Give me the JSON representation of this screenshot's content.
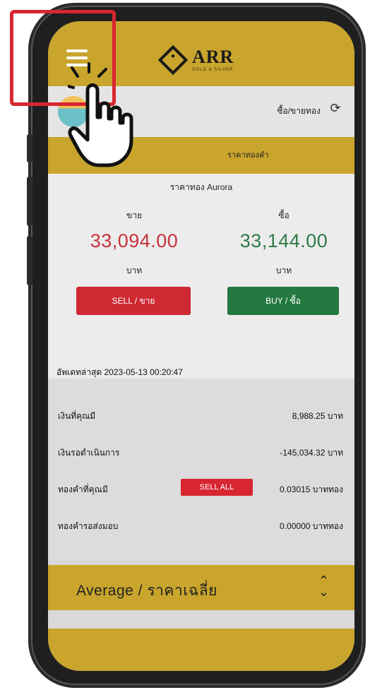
{
  "header": {
    "logo_text": "ARR",
    "logo_subtitle": "GOLD & SILVER"
  },
  "info_strip": {
    "text": "ซื้อ/ขายทอง"
  },
  "tab_strip": {
    "label": "ราคาทองคำ"
  },
  "prices": {
    "title": "ราคาทอง Aurora",
    "sell": {
      "label": "ขาย",
      "value": "33,094.00",
      "unit": "บาท",
      "button": "SELL / ขาย"
    },
    "buy": {
      "label": "ซื้อ",
      "value": "33,144.00",
      "unit": "บาท",
      "button": "BUY / ซื้อ"
    },
    "updated": "อัพเดทล่าสุด 2023-05-13 00:20:47"
  },
  "account": {
    "rows": [
      {
        "label": "เงินที่คุณมี",
        "value": "8,988.25 บาท"
      },
      {
        "label": "เงินรอดำเนินการ",
        "value": "-145,034.32 บาท"
      },
      {
        "label": "ทองคำที่คุณมี",
        "value": "0.03015 บาททอง",
        "action": "SELL ALL"
      },
      {
        "label": "ทองคำรอส่งมอบ",
        "value": "0.00000 บาททอง"
      }
    ]
  },
  "average": {
    "label": "Average / ราคาเฉลี่ย"
  },
  "colors": {
    "gold": "#c9a52d",
    "sell_red": "#c8323c",
    "buy_green": "#2f7a47",
    "highlight": "#d8262f"
  },
  "icons": [
    "hamburger-menu-icon",
    "refresh-icon",
    "select-chevron-icon",
    "hand-pointer-icon"
  ]
}
